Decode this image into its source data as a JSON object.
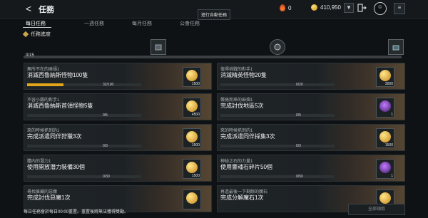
{
  "header": {
    "back_glyph": "<",
    "title": "任務",
    "currency": [
      {
        "icon": "fire-drop-icon",
        "value": "0"
      },
      {
        "icon": "gold-coin-icon",
        "value": "410,950"
      }
    ]
  },
  "tabs": [
    {
      "label": "每日任務",
      "active": true
    },
    {
      "label": "一週任務",
      "active": false
    },
    {
      "label": "每月任務",
      "active": false
    },
    {
      "label": "公會任務",
      "active": false
    }
  ],
  "tooltip": "進行自動任務",
  "progress": {
    "label": "任務進度",
    "track_label": "0/15",
    "value": 0,
    "max": 15
  },
  "quests": [
    {
      "category": "無所不在的麻煩1",
      "name": "消滅西魯納斯怪物100隻",
      "progress_text": "32/100",
      "progress": 0.32,
      "reward_type": "gold",
      "reward_amount": "1500"
    },
    {
      "category": "值得挑戰的對手1",
      "name": "消滅精英怪物20隻",
      "progress_text": "0/20",
      "progress": 0,
      "reward_type": "gold",
      "reward_amount": "3000"
    },
    {
      "category": "不容小覷的對手1",
      "name": "消滅西魯納斯首領怪物5隻",
      "progress_text": "0/5",
      "progress": 0,
      "reward_type": "gold",
      "reward_amount": "4500"
    },
    {
      "category": "襲捲而來的麻煩1",
      "name": "完成討伐地區5次",
      "progress_text": "0/5",
      "progress": 0,
      "reward_type": "gem",
      "reward_amount": "1"
    },
    {
      "category": "來的時候抓到的1",
      "name": "完成派遣同伴狩獵3次",
      "progress_text": "0/3",
      "progress": 0,
      "reward_type": "gold",
      "reward_amount": "1500"
    },
    {
      "category": "來的時候抓到的1",
      "name": "完成派遣同伴採集3次",
      "progress_text": "0/3",
      "progress": 0,
      "reward_type": "gold",
      "reward_amount": "1500"
    },
    {
      "category": "體內的潛力1",
      "name": "使用開放潛力裝備30個",
      "progress_text": "0/30",
      "progress": 0,
      "reward_type": "gold",
      "reward_amount": "1500"
    },
    {
      "category": "神秘之石的力量1",
      "name": "使用靈魂石碎片50個",
      "progress_text": "0/50",
      "progress": 0,
      "reward_type": "gem",
      "reward_amount": "1"
    },
    {
      "category": "尋找躲藏的惡魔",
      "name": "完成討伐惡魔1次",
      "progress_text": "",
      "progress": 0,
      "reward_type": "gold",
      "reward_amount": ""
    },
    {
      "category": "再造最後一下剩餘的魔石",
      "name": "完成分解魔石1次",
      "progress_text": "",
      "progress": 0,
      "reward_type": "gold",
      "reward_amount": ""
    }
  ],
  "footer": {
    "note": "每日任務會於每日00:00重置。重置後將無法獲得獎勵。",
    "claim_all": "全部領取"
  }
}
